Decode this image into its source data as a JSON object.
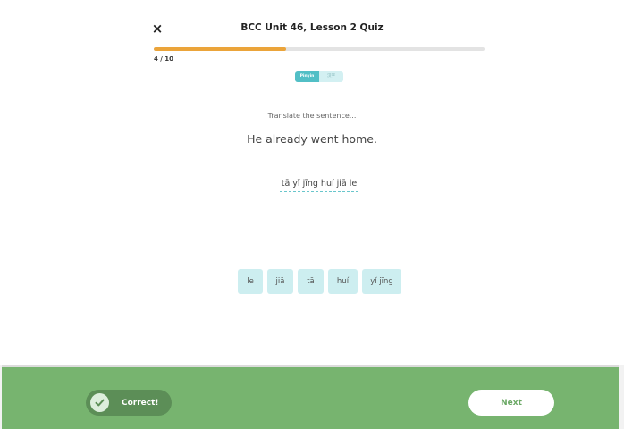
{
  "header": {
    "close_icon": "×",
    "title": "BCC Unit 46, Lesson 2 Quiz"
  },
  "progress": {
    "current": 4,
    "total": 10,
    "label": "4 / 10",
    "fraction": 0.4,
    "fill_color": "#eba43a"
  },
  "mode_toggle": {
    "options": [
      "Pinyin",
      "汉字"
    ],
    "selected": "Pinyin"
  },
  "question": {
    "instruction": "Translate the sentence...",
    "prompt": "He already went home.",
    "answer": "tā yǐ jīng huí jiā le"
  },
  "word_bank": {
    "chips": [
      "le",
      "jiā",
      "tā",
      "huí",
      "yǐ jīng"
    ]
  },
  "footer": {
    "status": "Correct!",
    "status_icon": "check-icon",
    "next_label": "Next",
    "background_color": "#77b46f"
  }
}
